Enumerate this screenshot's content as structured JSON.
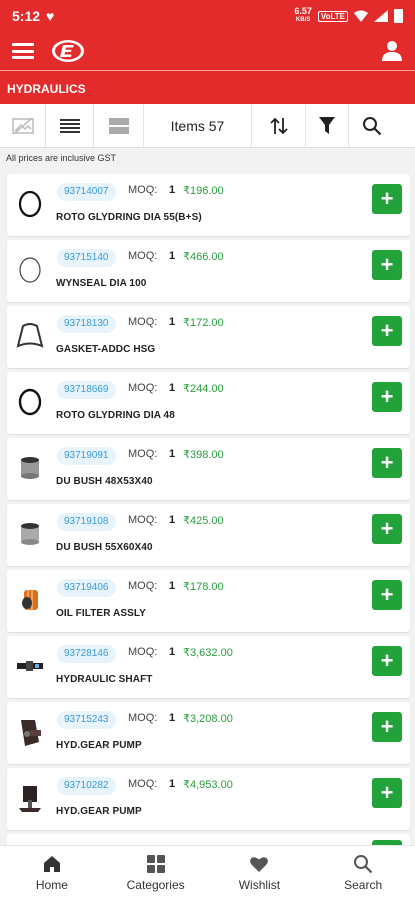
{
  "status": {
    "time": "5:12",
    "net_speed": "6.57",
    "net_unit": "KB/S",
    "volte": "VoLTE"
  },
  "header": {
    "logo_icon": "brand-logo-icon",
    "user_icon": "user-icon",
    "menu_icon": "hamburger-icon"
  },
  "category": {
    "title": "HYDRAULICS"
  },
  "toolbar": {
    "items_label": "Items 57"
  },
  "note": "All prices are inclusive GST",
  "products": [
    {
      "code": "93714007",
      "moq_label": "MOQ:",
      "moq": "1",
      "price": "₹196.00",
      "name": "ROTO GLYDRING DIA 55(B+S)",
      "icon": "o-ring-icon"
    },
    {
      "code": "93715140",
      "moq_label": "MOQ:",
      "moq": "1",
      "price": "₹466.00",
      "name": "WYNSEAL DIA 100",
      "icon": "seal-ring-icon"
    },
    {
      "code": "93718130",
      "moq_label": "MOQ:",
      "moq": "1",
      "price": "₹172.00",
      "name": "GASKET-ADDC HSG",
      "icon": "gasket-icon"
    },
    {
      "code": "93718669",
      "moq_label": "MOQ:",
      "moq": "1",
      "price": "₹244.00",
      "name": "ROTO GLYDRING DIA 48",
      "icon": "o-ring-icon"
    },
    {
      "code": "93719091",
      "moq_label": "MOQ:",
      "moq": "1",
      "price": "₹398.00",
      "name": "DU BUSH 48X53X40",
      "icon": "bush-icon"
    },
    {
      "code": "93719108",
      "moq_label": "MOQ:",
      "moq": "1",
      "price": "₹425.00",
      "name": "DU BUSH 55X60X40",
      "icon": "bush-icon"
    },
    {
      "code": "93719406",
      "moq_label": "MOQ:",
      "moq": "1",
      "price": "₹178.00",
      "name": "OIL FILTER ASSLY",
      "icon": "oil-filter-icon"
    },
    {
      "code": "93728146",
      "moq_label": "MOQ:",
      "moq": "1",
      "price": "₹3,632.00",
      "name": "HYDRAULIC SHAFT",
      "icon": "shaft-icon"
    },
    {
      "code": "93715243",
      "moq_label": "MOQ:",
      "moq": "1",
      "price": "₹3,208.00",
      "name": "HYD.GEAR PUMP",
      "icon": "gear-pump-icon"
    },
    {
      "code": "93710282",
      "moq_label": "MOQ:",
      "moq": "1",
      "price": "₹4,953.00",
      "name": "HYD.GEAR PUMP",
      "icon": "gear-pump-icon"
    }
  ],
  "add_label": "+",
  "nav": [
    {
      "label": "Home",
      "icon": "home-icon"
    },
    {
      "label": "Categories",
      "icon": "categories-icon"
    },
    {
      "label": "Wishlist",
      "icon": "heart-icon"
    },
    {
      "label": "Search",
      "icon": "search-icon"
    }
  ],
  "colors": {
    "primary": "#e32b2b",
    "add_button": "#22a33a",
    "price": "#2a9d3e",
    "code_text": "#3a9ad9"
  }
}
